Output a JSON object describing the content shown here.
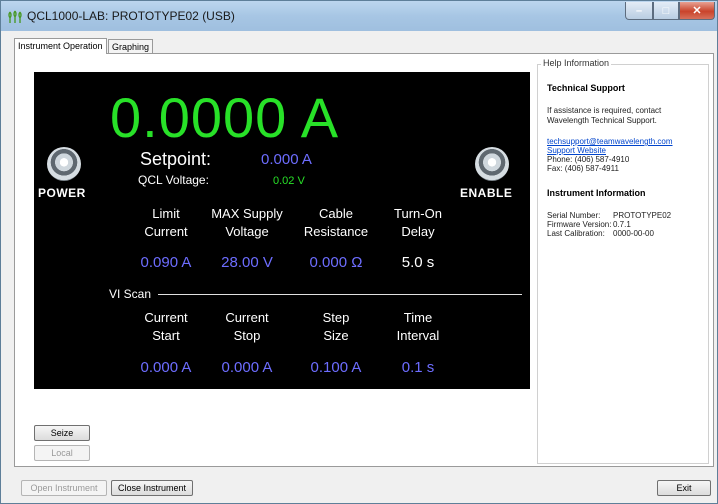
{
  "window": {
    "title": "QCL1000-LAB: PROTOTYPE02 (USB)",
    "minimize": "–",
    "maximize": "□",
    "close": "✕"
  },
  "tabs": [
    {
      "label": "Instrument Operation",
      "active": true
    },
    {
      "label": "Graphing",
      "active": false
    }
  ],
  "display": {
    "current_readout": "0.0000 A",
    "power_label": "POWER",
    "enable_label": "ENABLE",
    "setpoint_label": "Setpoint:",
    "setpoint_value": "0.000 A",
    "qcl_voltage_label": "QCL Voltage:",
    "qcl_voltage_value": "0.02 V",
    "params": [
      {
        "line1": "Limit",
        "line2": "Current",
        "value": "0.090 A"
      },
      {
        "line1": "MAX Supply",
        "line2": "Voltage",
        "value": "28.00 V"
      },
      {
        "line1": "Cable",
        "line2": "Resistance",
        "value": "0.000 Ω"
      },
      {
        "line1": "Turn-On",
        "line2": "Delay",
        "value": "5.0 s"
      }
    ],
    "vi_scan_label": "VI Scan",
    "vi_params": [
      {
        "line1": "Current",
        "line2": "Start",
        "value": "0.000 A"
      },
      {
        "line1": "Current",
        "line2": "Stop",
        "value": "0.000 A"
      },
      {
        "line1": "Step",
        "line2": "Size",
        "value": "0.100 A"
      },
      {
        "line1": "Time",
        "line2": "Interval",
        "value": "0.1 s"
      }
    ],
    "colors": {
      "readout": "#28e128",
      "value": "#6d6dff",
      "label": "#ffffff"
    }
  },
  "buttons": {
    "seize": "Seize",
    "local": "Local",
    "open_instrument": "Open Instrument",
    "close_instrument": "Close Instrument",
    "exit": "Exit"
  },
  "help": {
    "legend": "Help Information",
    "support_heading": "Technical Support",
    "support_text_1": "If assistance is required, contact",
    "support_text_2": "Wavelength Technical Support.",
    "email": "techsupport@teamwavelength.com",
    "website": "Support Website",
    "phone": "Phone: (406) 587-4910",
    "fax": "Fax: (406) 587-4911",
    "info_heading": "Instrument Information",
    "serial_label": "Serial Number:",
    "serial_value": "PROTOTYPE02",
    "firmware_label": "Firmware Version:",
    "firmware_value": "0.7.1",
    "calibration_label": "Last Calibration:",
    "calibration_value": "0000-00-00"
  }
}
